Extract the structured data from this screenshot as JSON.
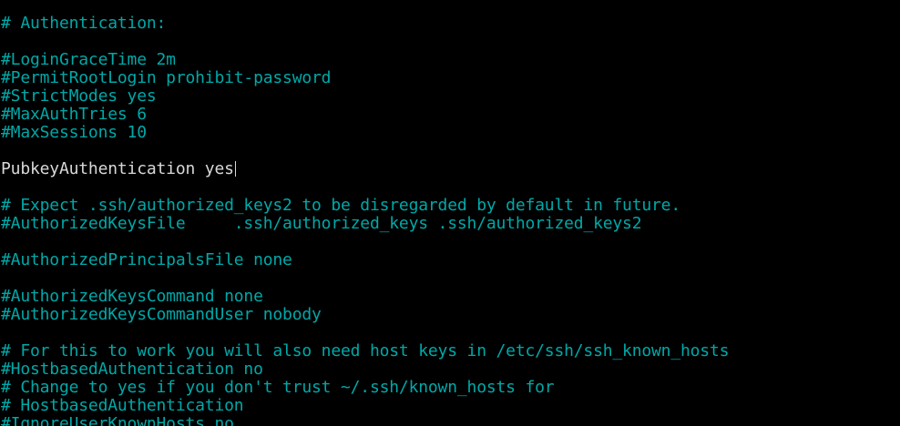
{
  "colors": {
    "background": "#000000",
    "comment_text": "#00a8a8",
    "active_text": "#d8d8d8"
  },
  "editor": {
    "lines": [
      {
        "text": "# Authentication:"
      },
      {
        "text": ""
      },
      {
        "text": "#LoginGraceTime 2m"
      },
      {
        "text": "#PermitRootLogin prohibit-password"
      },
      {
        "text": "#StrictModes yes"
      },
      {
        "text": "#MaxAuthTries 6"
      },
      {
        "text": "#MaxSessions 10"
      },
      {
        "text": ""
      },
      {
        "text": "PubkeyAuthentication yes"
      },
      {
        "text": ""
      },
      {
        "text": "# Expect .ssh/authorized_keys2 to be disregarded by default in future."
      },
      {
        "text": "#AuthorizedKeysFile     .ssh/authorized_keys .ssh/authorized_keys2"
      },
      {
        "text": ""
      },
      {
        "text": "#AuthorizedPrincipalsFile none"
      },
      {
        "text": ""
      },
      {
        "text": "#AuthorizedKeysCommand none"
      },
      {
        "text": "#AuthorizedKeysCommandUser nobody"
      },
      {
        "text": ""
      },
      {
        "text": "# For this to work you will also need host keys in /etc/ssh/ssh_known_hosts"
      },
      {
        "text": "#HostbasedAuthentication no"
      },
      {
        "text": "# Change to yes if you don't trust ~/.ssh/known_hosts for"
      },
      {
        "text": "# HostbasedAuthentication"
      },
      {
        "text": "#IgnoreUserKnownHosts no"
      }
    ]
  }
}
